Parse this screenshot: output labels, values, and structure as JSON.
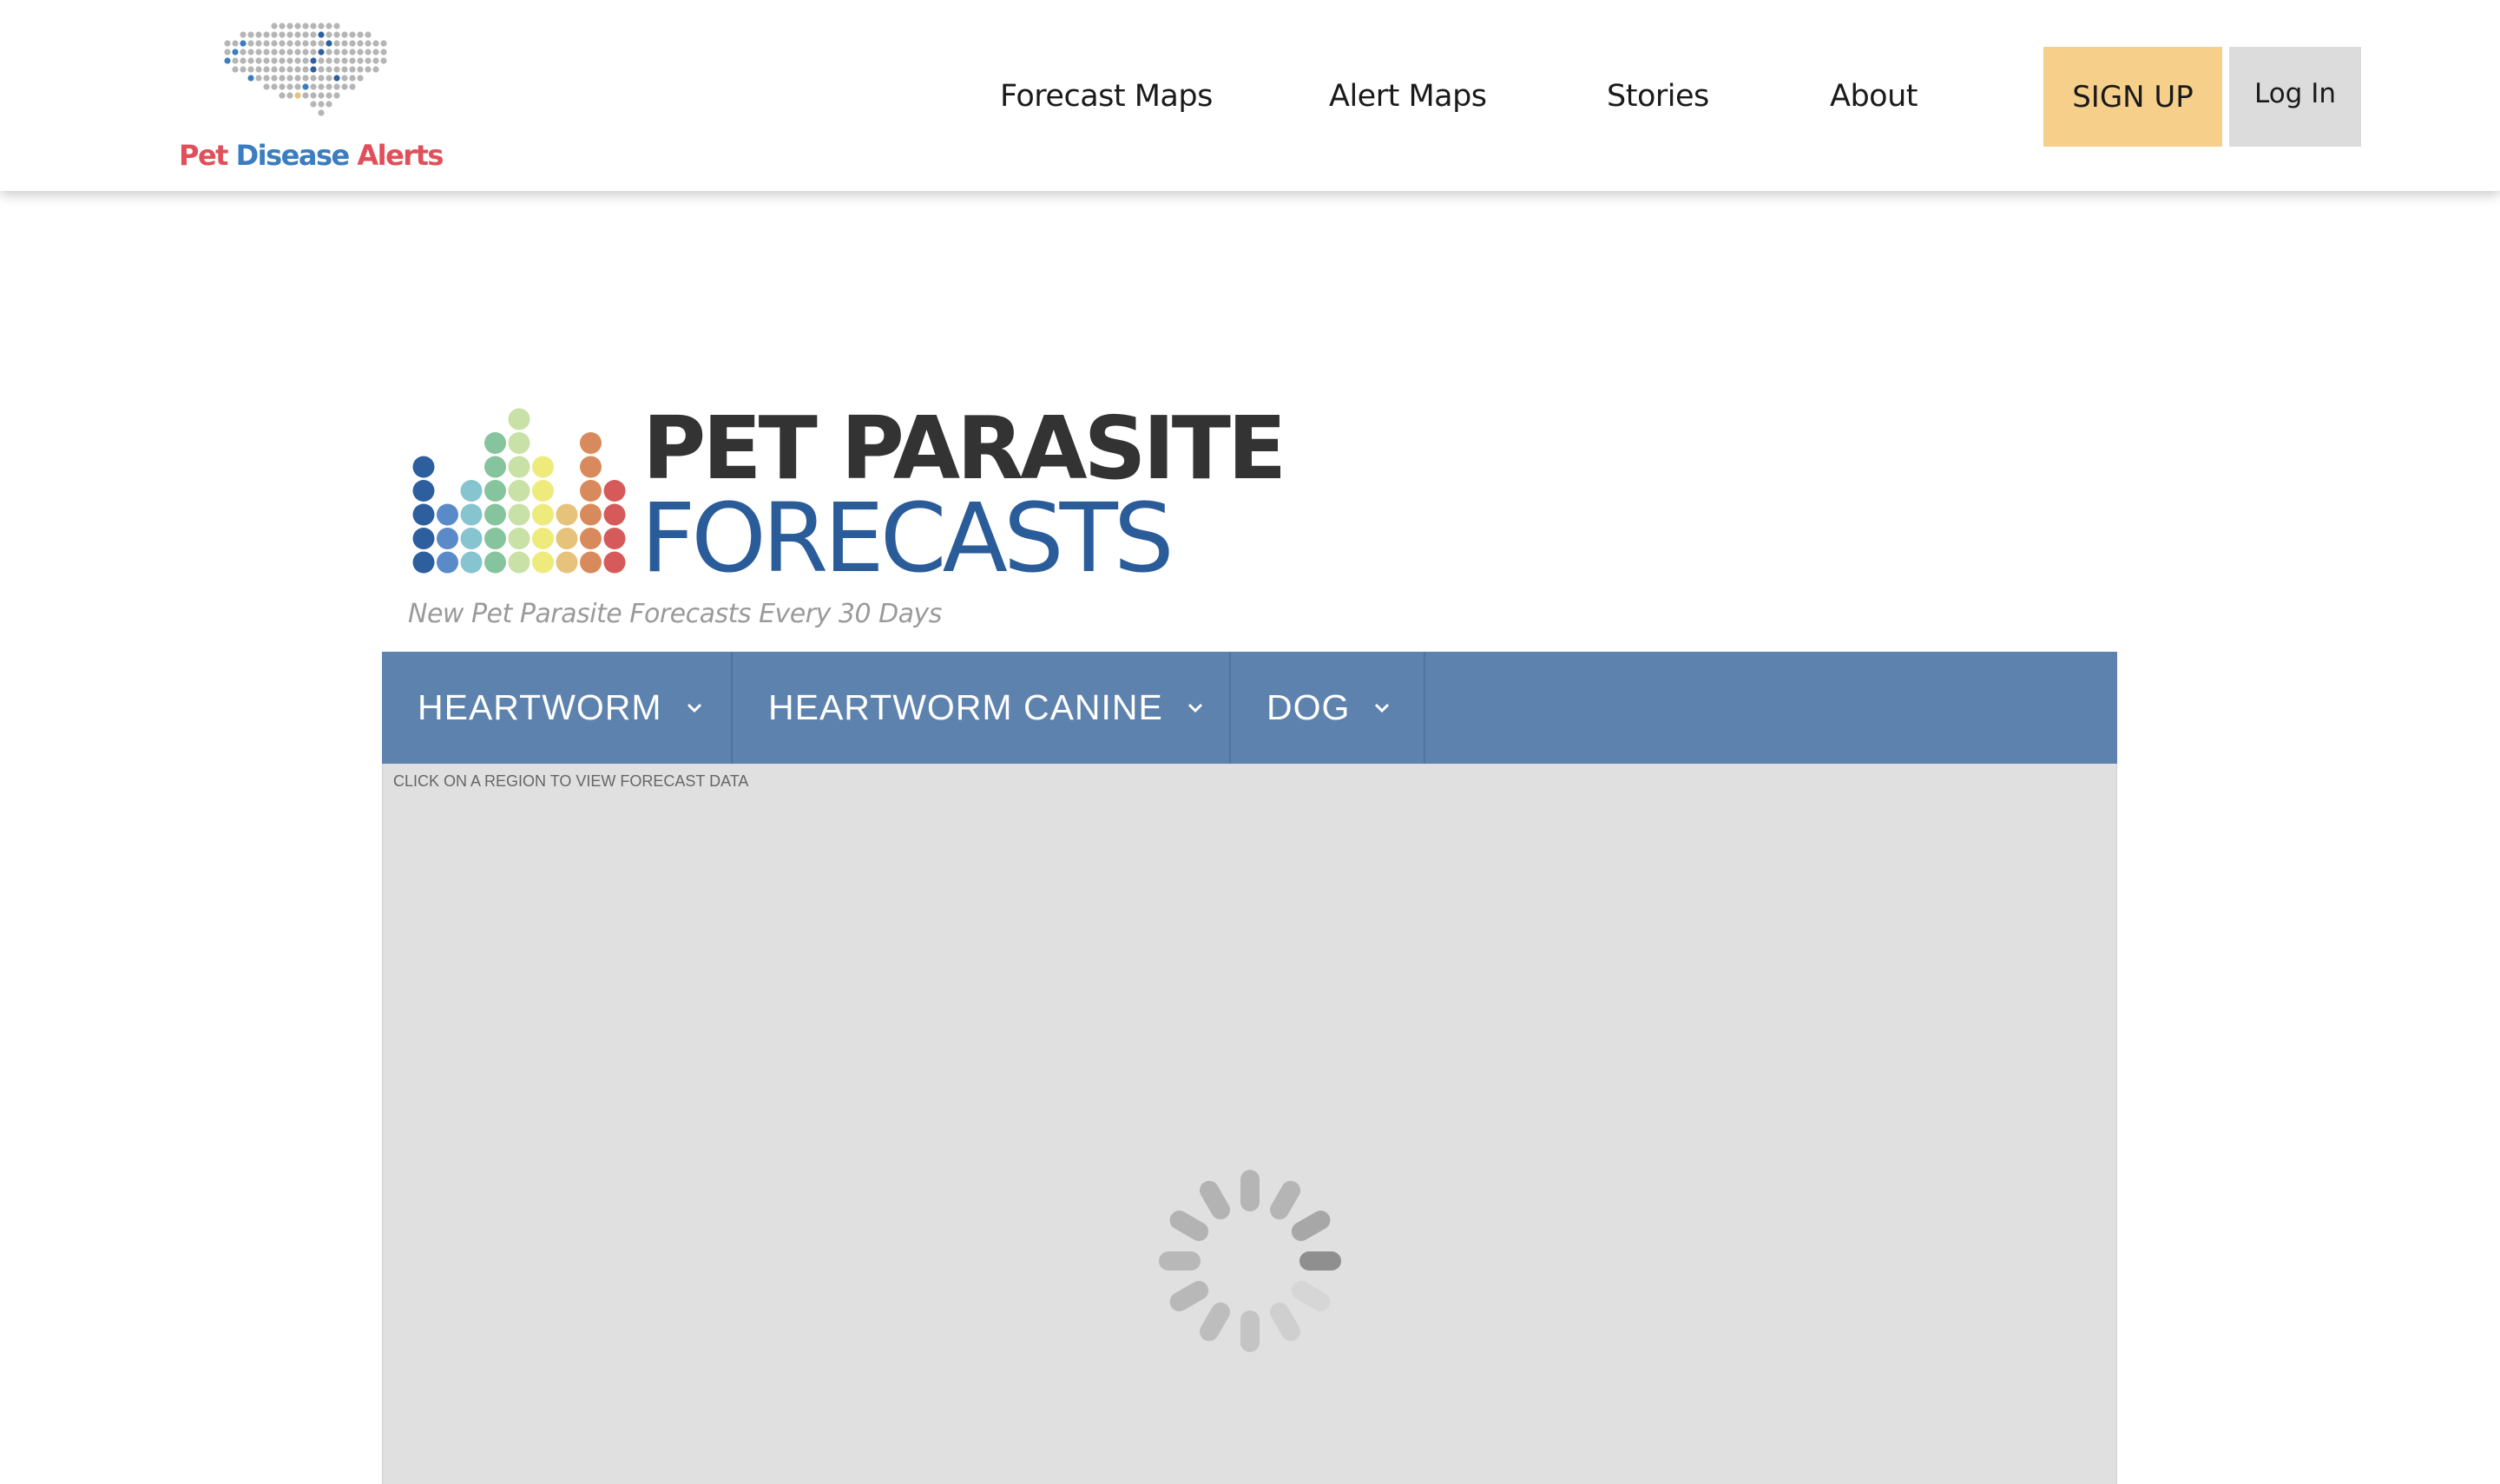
{
  "header": {
    "brand": {
      "word1": "Pet",
      "word2": "Disease",
      "word3": "Alerts",
      "icon": "us-map-dots-logo"
    },
    "nav": [
      {
        "label": "Forecast Maps"
      },
      {
        "label": "Alert Maps"
      },
      {
        "label": "Stories"
      },
      {
        "label": "About"
      }
    ],
    "signup_label": "SIGN UP",
    "login_label": "Log In"
  },
  "hero": {
    "title_line1": "PET PARASITE",
    "title_line2": "FORECASTS",
    "tagline": "New Pet Parasite Forecasts Every 30 Days",
    "icon": "dot-bar-chart-logo"
  },
  "filters": [
    {
      "label": "HEARTWORM",
      "icon": "chevron-down-icon"
    },
    {
      "label": "HEARTWORM CANINE",
      "icon": "chevron-down-icon"
    },
    {
      "label": "DOG",
      "icon": "chevron-down-icon"
    }
  ],
  "map": {
    "hint": "CLICK ON A REGION TO VIEW FORECAST DATA",
    "status_icon": "loading-spinner-icon"
  },
  "colors": {
    "brand_red": "#e0505a",
    "brand_blue": "#3a7dc0",
    "signup_bg": "#f6d08a",
    "login_bg": "#dcdcdc",
    "filter_bar": "#5c82ad",
    "map_bg": "#e0e0e0",
    "forecast_title_blue": "#2a5c9a"
  }
}
